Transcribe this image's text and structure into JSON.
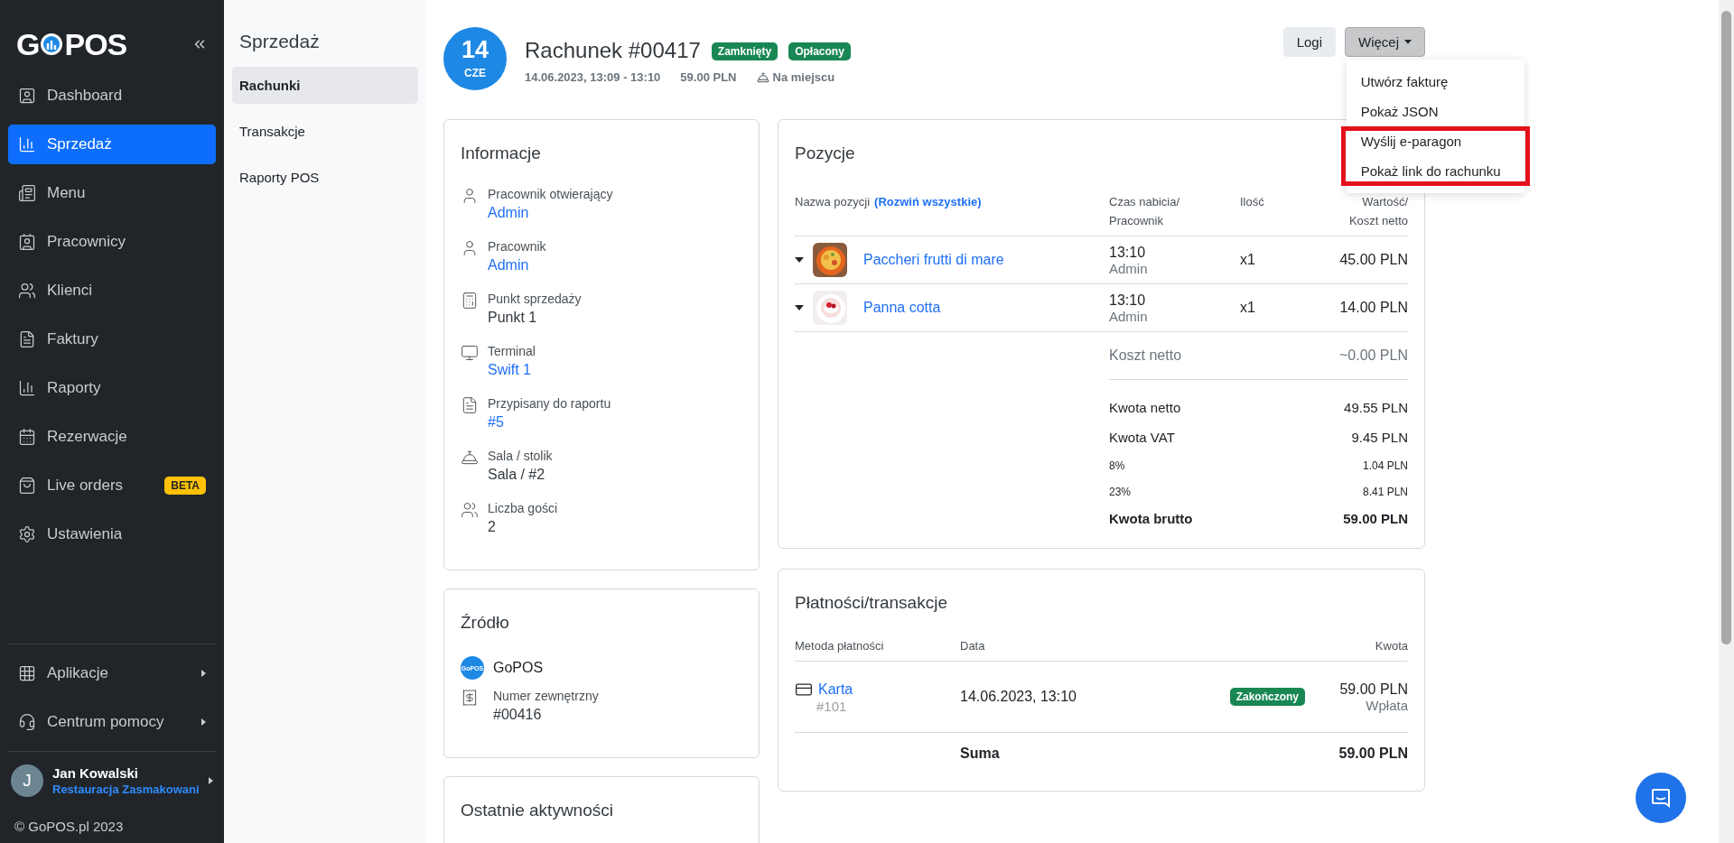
{
  "logo": {
    "left": "G",
    "right": "POS"
  },
  "sidebar": {
    "items": [
      {
        "label": "Dashboard",
        "selected": false
      },
      {
        "label": "Sprzedaż",
        "selected": true
      },
      {
        "label": "Menu",
        "selected": false
      },
      {
        "label": "Pracownicy",
        "selected": false
      },
      {
        "label": "Klienci",
        "selected": false
      },
      {
        "label": "Faktury",
        "selected": false
      },
      {
        "label": "Raporty",
        "selected": false
      },
      {
        "label": "Rezerwacje",
        "selected": false
      },
      {
        "label": "Live orders",
        "selected": false,
        "badge": "BETA"
      },
      {
        "label": "Ustawienia",
        "selected": false
      }
    ],
    "bottom_items": [
      {
        "label": "Aplikacje",
        "has_submenu": true
      },
      {
        "label": "Centrum pomocy",
        "has_submenu": true
      }
    ],
    "user": {
      "initial": "J",
      "name": "Jan Kowalski",
      "company": "Restauracja Zasmakowani"
    },
    "copyright": "© GoPOS.pl 2023"
  },
  "subnav": {
    "title": "Sprzedaż",
    "items": [
      {
        "label": "Rachunki",
        "selected": true
      },
      {
        "label": "Transakcje",
        "selected": false
      },
      {
        "label": "Raporty POS",
        "selected": false
      }
    ]
  },
  "header": {
    "day": "14",
    "month": "CZE",
    "title": "Rachunek #00417",
    "badges": [
      "Zamknięty",
      "Opłacony"
    ],
    "date_range": "14.06.2023, 13:09 - 13:10",
    "amount": "59.00 PLN",
    "service": "Na miejscu"
  },
  "buttons": [
    {
      "label": "Logi",
      "kind": "plain"
    },
    {
      "label": "Więcej",
      "kind": "dropdown"
    }
  ],
  "dropdown": {
    "items": [
      {
        "label": "Utwórz fakturę",
        "highlighted": false
      },
      {
        "label": "Pokaż JSON",
        "highlighted": false
      },
      {
        "label": "Wyślij e-paragon",
        "highlighted": true
      },
      {
        "label": "Pokaż link do rachunku",
        "highlighted": true
      }
    ]
  },
  "info": {
    "title": "Informacje",
    "fields": [
      {
        "label": "Pracownik otwierający",
        "value": "Admin",
        "link": true
      },
      {
        "label": "Pracownik",
        "value": "Admin",
        "link": true
      },
      {
        "label": "Punkt sprzedaży",
        "value": "Punkt 1",
        "link": false
      },
      {
        "label": "Terminal",
        "value": "Swift 1",
        "link": true
      },
      {
        "label": "Przypisany do raportu",
        "value": "#5",
        "link": true
      },
      {
        "label": "Sala / stolik",
        "value": "Sala / #2",
        "link": false
      },
      {
        "label": "Liczba gości",
        "value": "2",
        "link": false
      }
    ]
  },
  "source": {
    "title": "Źródło",
    "logo_text": "GoPOS",
    "name": "GoPOS",
    "fields": [
      {
        "label": "Numer zewnętrzny",
        "value": "#00416"
      }
    ]
  },
  "activity": {
    "title": "Ostatnie aktywności"
  },
  "positions": {
    "title": "Pozycje",
    "columns": [
      "Nazwa pozycji",
      "Czas nabicia/ Pracownik",
      "Ilość",
      "Wartość/ Koszt netto"
    ],
    "expand_link": "(Rozwiń wszystkie)",
    "rows": [
      {
        "name": "Paccheri frutti di mare",
        "time": "13:10",
        "employee": "Admin",
        "qty": "x1",
        "value": "45.00 PLN"
      },
      {
        "name": "Panna cotta",
        "time": "13:10",
        "employee": "Admin",
        "qty": "x1",
        "value": "14.00 PLN"
      }
    ],
    "net_cost": {
      "label": "Koszt netto",
      "value": "~0.00 PLN"
    },
    "totals": [
      {
        "label": "Kwota netto",
        "value": "49.55 PLN",
        "kind": "main"
      },
      {
        "label": "Kwota VAT",
        "value": "9.45 PLN",
        "kind": "main"
      },
      {
        "label": "8%",
        "value": "1.04 PLN",
        "kind": "tax"
      },
      {
        "label": "23%",
        "value": "8.41 PLN",
        "kind": "tax"
      },
      {
        "label": "Kwota brutto",
        "value": "59.00 PLN",
        "kind": "total"
      }
    ]
  },
  "payments": {
    "title": "Płatności/transakcje",
    "columns": [
      "Metoda płatności",
      "Data",
      "Kwota"
    ],
    "rows": [
      {
        "method": "Karta",
        "number": "#101",
        "date": "14.06.2023, 13:10",
        "status": "Zakończony",
        "amount": "59.00 PLN",
        "type": "Wpłata"
      }
    ],
    "sum_label": "Suma",
    "sum_value": "59.00 PLN"
  }
}
